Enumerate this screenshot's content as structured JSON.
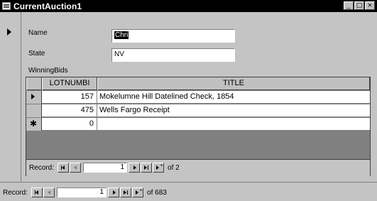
{
  "window": {
    "title": "CurrentAuction1",
    "buttons": [
      "_",
      "□",
      "×"
    ]
  },
  "form": {
    "name_label": "Name",
    "name_value": "Chri",
    "state_label": "State",
    "state_value": "NV",
    "subform_label": "WinningBids"
  },
  "subform": {
    "columns": [
      "LOTNUMBI",
      "TITLE"
    ],
    "rows": [
      {
        "lot": "157",
        "title": "Mokelumne Hill Datelined Check, 1854"
      },
      {
        "lot": "475",
        "title": "Wells Fargo Receipt"
      },
      {
        "lot": "0",
        "title": ""
      }
    ],
    "nav": {
      "label": "Record:",
      "current": "1",
      "of_text": "of 2"
    }
  },
  "main_nav": {
    "label": "Record:",
    "current": "1",
    "of_text": "of 683"
  },
  "colors": {
    "titlebar": "#000000",
    "face": "#c4c4c4",
    "subform_bg": "#808080"
  }
}
